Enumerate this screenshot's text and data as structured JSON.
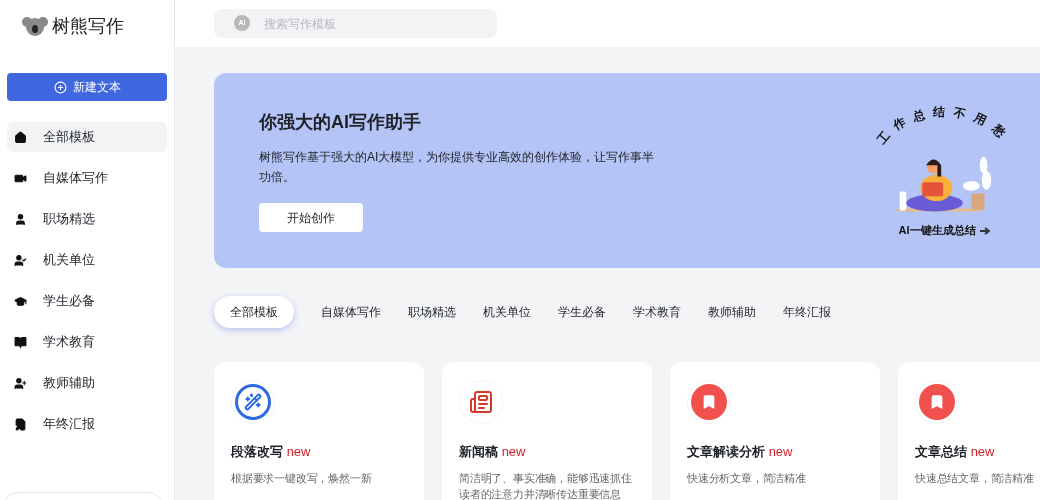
{
  "logo": {
    "name": "树熊写作"
  },
  "search": {
    "placeholder": "搜索写作模板",
    "badge": "AI"
  },
  "new_button": {
    "label": "新建文本"
  },
  "sidebar": {
    "items": [
      {
        "label": "全部模板",
        "selected": true
      },
      {
        "label": "自媒体写作",
        "selected": false
      },
      {
        "label": "职场精选",
        "selected": false
      },
      {
        "label": "机关单位",
        "selected": false
      },
      {
        "label": "学生必备",
        "selected": false
      },
      {
        "label": "学术教育",
        "selected": false
      },
      {
        "label": "教师辅助",
        "selected": false
      },
      {
        "label": "年终汇报",
        "selected": false
      }
    ]
  },
  "banner": {
    "title": "你强大的AI写作助手",
    "description": "树熊写作基于强大的AI大模型，为你提供专业高效的创作体验，让写作事半功倍。",
    "button": "开始创作",
    "art_heading": "工作总结不用愁",
    "art_caption": "AI一键生成总结"
  },
  "tabs": [
    {
      "label": "全部模板",
      "selected": true
    },
    {
      "label": "自媒体写作",
      "selected": false
    },
    {
      "label": "职场精选",
      "selected": false
    },
    {
      "label": "机关单位",
      "selected": false
    },
    {
      "label": "学生必备",
      "selected": false
    },
    {
      "label": "学术教育",
      "selected": false
    },
    {
      "label": "教师辅助",
      "selected": false
    },
    {
      "label": "年终汇报",
      "selected": false
    }
  ],
  "cards": [
    {
      "title": "段落改写",
      "badge": "new",
      "description": [
        "根据要求一键改写，焕然一新"
      ]
    },
    {
      "title": "新闻稿",
      "badge": "new",
      "description": [
        "简洁明了、事实准确，能够迅速抓住",
        "读者的注意力并清晰传达重要信息"
      ]
    },
    {
      "title": "文章解读分析",
      "badge": "new",
      "description": [
        "快速分析文章，简洁精准"
      ]
    },
    {
      "title": "文章总结",
      "badge": "new",
      "description": [
        "快速总结文章，简洁精准"
      ]
    }
  ]
}
